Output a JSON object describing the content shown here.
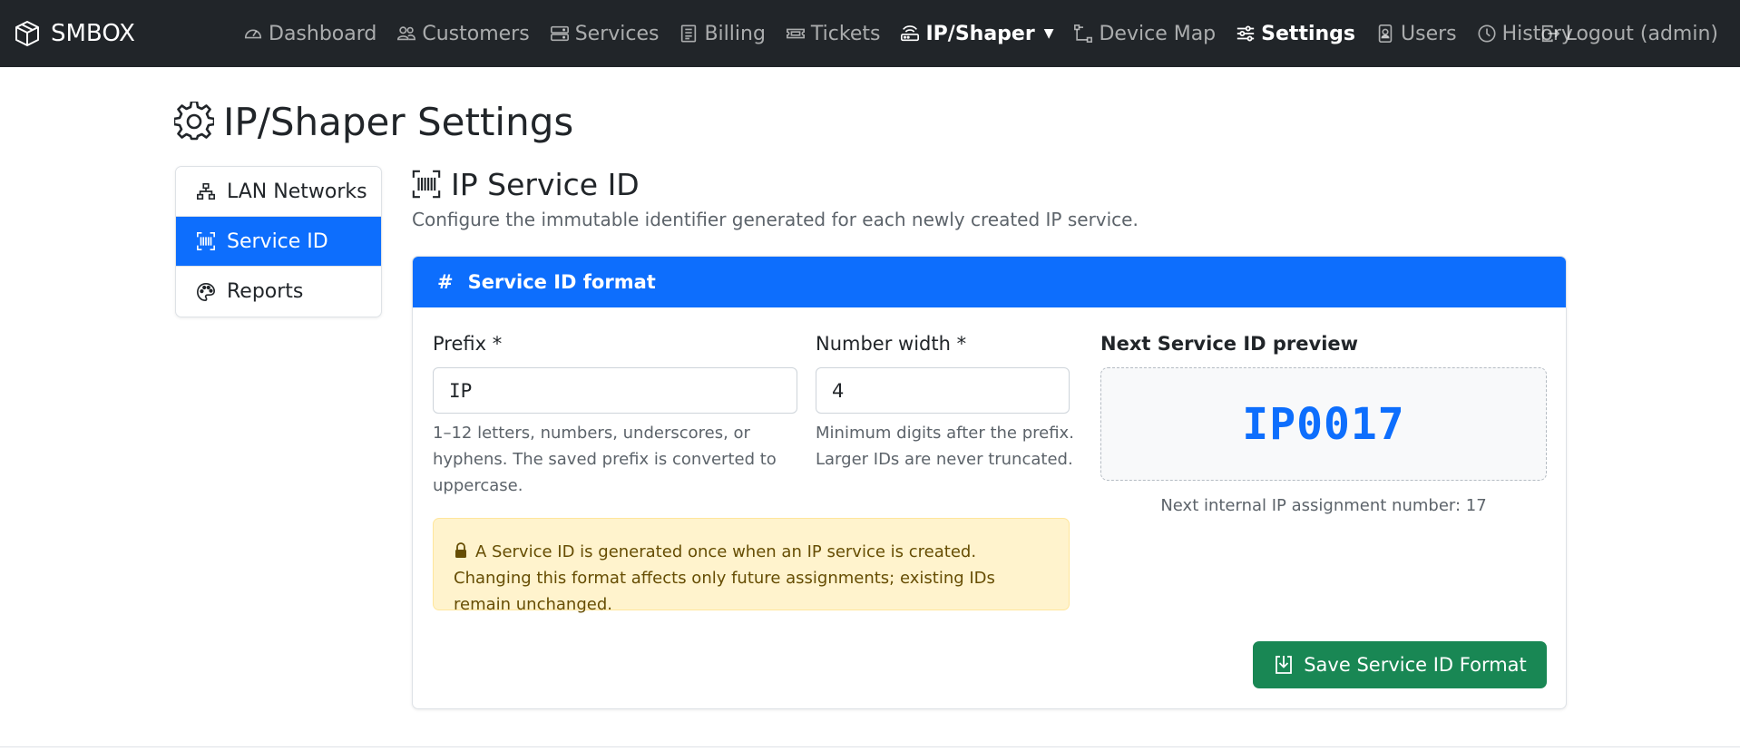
{
  "navbar": {
    "brand": "SMBOX",
    "items": [
      {
        "label": "Dashboard",
        "icon": "speedometer-icon"
      },
      {
        "label": "Customers",
        "icon": "people-icon"
      },
      {
        "label": "Services",
        "icon": "hdd-stack-icon"
      },
      {
        "label": "Billing",
        "icon": "receipt-icon"
      },
      {
        "label": "Tickets",
        "icon": "ticket-icon"
      },
      {
        "label": "IP/Shaper",
        "icon": "router-icon",
        "dropdown": true,
        "active": true
      },
      {
        "label": "Device Map",
        "icon": "diagram-icon"
      },
      {
        "label": "Settings",
        "icon": "sliders-icon",
        "active": true
      },
      {
        "label": "Users",
        "icon": "person-badge-icon"
      },
      {
        "label": "History",
        "icon": "clock-history-icon"
      }
    ],
    "logout": "Logout (admin)"
  },
  "page": {
    "title": "IP/Shaper Settings"
  },
  "sidebar": {
    "items": [
      {
        "label": "LAN Networks",
        "icon": "diagram-3-icon"
      },
      {
        "label": "Service ID",
        "icon": "upc-scan-icon",
        "active": true
      },
      {
        "label": "Reports",
        "icon": "palette-icon"
      }
    ]
  },
  "section": {
    "title": "IP Service ID",
    "description": "Configure the immutable identifier generated for each newly created IP service."
  },
  "card": {
    "header": "Service ID format",
    "prefix": {
      "label": "Prefix *",
      "value": "IP",
      "help": "1–12 letters, numbers, underscores, or hyphens. The saved prefix is converted to uppercase."
    },
    "width": {
      "label": "Number width *",
      "value": "4",
      "help": "Minimum digits after the prefix. Larger IDs are never truncated."
    },
    "preview": {
      "label": "Next Service ID preview",
      "value": "IP0017",
      "note": "Next internal IP assignment number: 17"
    },
    "alert": "A Service ID is generated once when an IP service is created. Changing this format affects only future assignments; existing IDs remain unchanged.",
    "save_label": "Save Service ID Format"
  },
  "colors": {
    "navbar_bg": "#212529",
    "primary": "#0d6efd",
    "success": "#198754",
    "warning_bg": "#fff3cd"
  }
}
